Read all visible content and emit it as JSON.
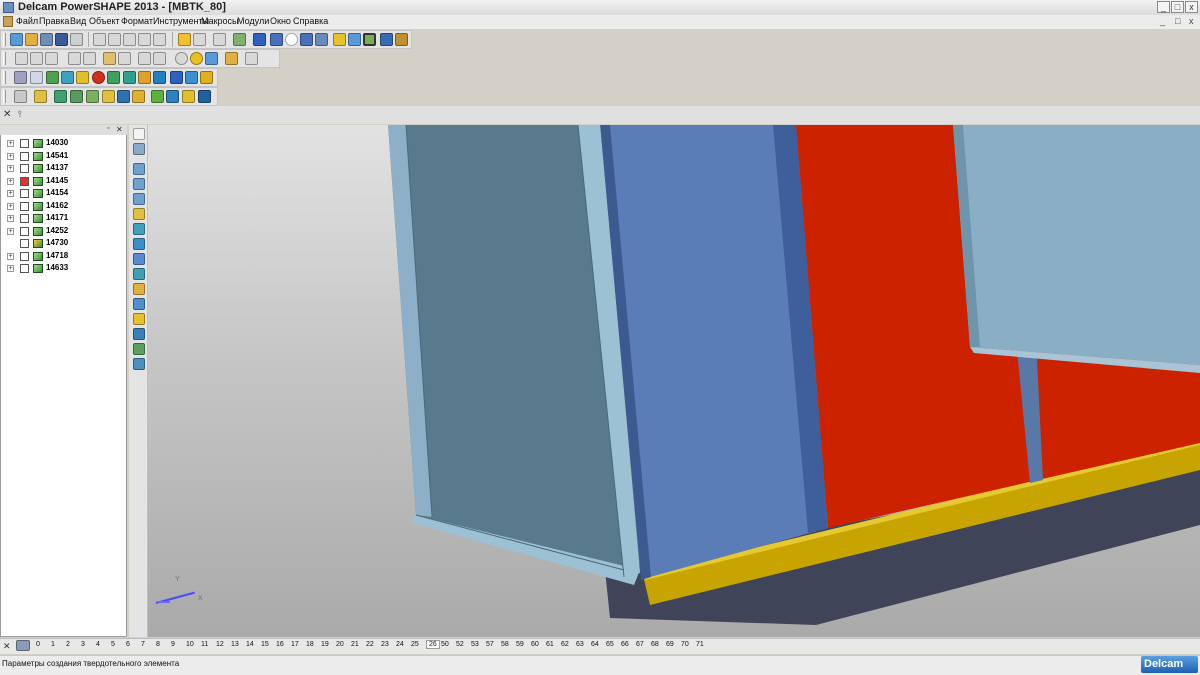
{
  "window": {
    "title": "Delcam PowerSHAPE 2013 - [MBTK_80]",
    "buttons": [
      "_",
      "□",
      "x"
    ]
  },
  "menu": {
    "items": [
      "Файл",
      "Правка",
      "Вид",
      "Объект",
      "Формат",
      "Инструменты",
      "Макросы",
      "Модули",
      "Окно",
      "Справка"
    ],
    "doc_buttons": [
      "_",
      "□",
      "x"
    ]
  },
  "tree": {
    "items": [
      {
        "label": "14030",
        "expandable": true,
        "icon": "green-solid-icon"
      },
      {
        "label": "14541",
        "expandable": true,
        "icon": "green-solid-icon"
      },
      {
        "label": "14137",
        "expandable": true,
        "icon": "green-solid-icon"
      },
      {
        "label": "14145",
        "expandable": true,
        "icon": "red-solid-icon"
      },
      {
        "label": "14154",
        "expandable": true,
        "icon": "green-solid-icon"
      },
      {
        "label": "14162",
        "expandable": true,
        "icon": "green-solid-icon"
      },
      {
        "label": "14171",
        "expandable": true,
        "icon": "green-solid-icon"
      },
      {
        "label": "14252",
        "expandable": true,
        "icon": "green-solid-icon"
      },
      {
        "label": "14730",
        "expandable": false,
        "icon": "assembly-icon"
      },
      {
        "label": "14718",
        "expandable": true,
        "icon": "green-solid-icon"
      },
      {
        "label": "14633",
        "expandable": true,
        "icon": "green-solid-icon"
      }
    ]
  },
  "viewport": {
    "axis_y": "Y",
    "axis_x": "X",
    "colors": {
      "door_left": "#587a8c",
      "panel_blue": "#5a7db8",
      "panel_red": "#cc2200",
      "panel_light": "#8aaec4",
      "base_strip": "#c8a400",
      "base_dark": "#404458"
    }
  },
  "levels": {
    "numbers": [
      "0",
      "1",
      "2",
      "3",
      "4",
      "5",
      "6",
      "7",
      "8",
      "9",
      "10",
      "11",
      "12",
      "13",
      "14",
      "15",
      "16",
      "17",
      "18",
      "19",
      "20",
      "21",
      "22",
      "23",
      "24",
      "25",
      "26",
      "50",
      "52",
      "53",
      "57",
      "58",
      "59",
      "60",
      "61",
      "62",
      "63",
      "64",
      "65",
      "66",
      "67",
      "68",
      "69",
      "70",
      "71"
    ],
    "active": "26"
  },
  "status": {
    "text": "Параметры создания твердотельного элемента",
    "logo": "Delcam"
  }
}
